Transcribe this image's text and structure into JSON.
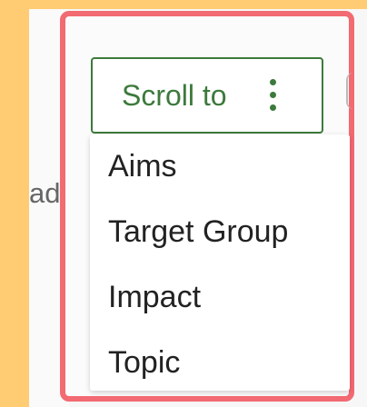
{
  "background_text": "ad th",
  "scroll_button": {
    "label": "Scroll to",
    "icon": "kebab-vertical-icon"
  },
  "menu": {
    "items": [
      "Aims",
      "Target Group",
      "Impact",
      "Topic"
    ]
  },
  "colors": {
    "accent_green": "#3C7A3C",
    "highlight_border": "#F26A72",
    "outer_background": "#FFCB73"
  }
}
